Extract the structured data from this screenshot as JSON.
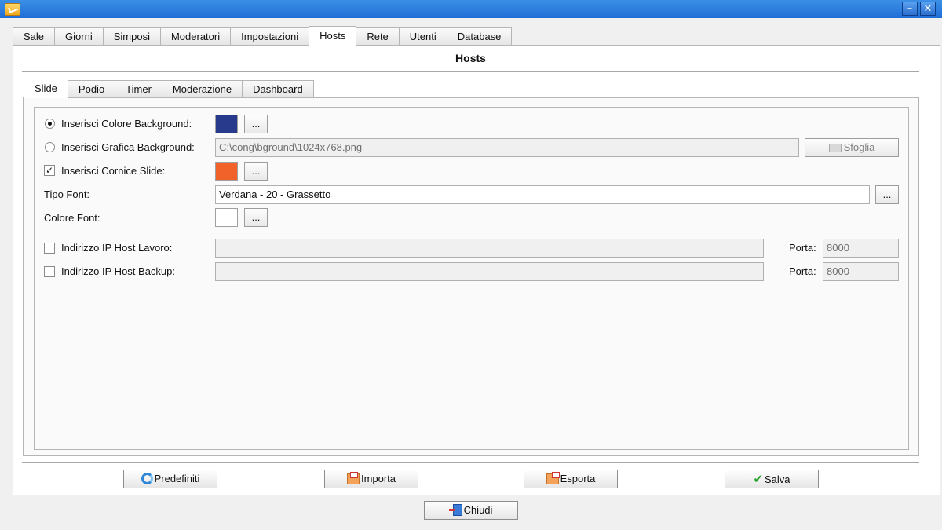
{
  "window": {
    "app_icon": "pencil-note-icon",
    "controls": {
      "minimize": "–",
      "close": "✕"
    }
  },
  "main_tabs": [
    {
      "label": "Sale"
    },
    {
      "label": "Giorni"
    },
    {
      "label": "Simposi"
    },
    {
      "label": "Moderatori"
    },
    {
      "label": "Impostazioni"
    },
    {
      "label": "Hosts",
      "active": true
    },
    {
      "label": "Rete"
    },
    {
      "label": "Utenti"
    },
    {
      "label": "Database"
    }
  ],
  "page_title": "Hosts",
  "sub_tabs": [
    {
      "label": "Slide",
      "active": true
    },
    {
      "label": "Podio"
    },
    {
      "label": "Timer"
    },
    {
      "label": "Moderazione"
    },
    {
      "label": "Dashboard"
    }
  ],
  "slide": {
    "background_color": {
      "label": "Inserisci Colore Background:",
      "selected": true,
      "color": "#273a8c",
      "browse_label": "..."
    },
    "background_image": {
      "label": "Inserisci Grafica Background:",
      "selected": false,
      "path": "C:\\cong\\bground\\1024x768.png",
      "browse_label": "Sfoglia",
      "browse_icon": "folder-icon"
    },
    "slide_frame": {
      "label": "Inserisci Cornice Slide:",
      "checked": true,
      "color": "#f0622a",
      "browse_label": "..."
    },
    "font_type": {
      "label": "Tipo Font:",
      "value": "Verdana - 20 - Grassetto",
      "browse_label": "..."
    },
    "font_color": {
      "label": "Colore Font:",
      "color": "#ffffff",
      "browse_label": "..."
    },
    "host_work": {
      "label": "Indirizzo IP Host Lavoro:",
      "checked": false,
      "ip": "",
      "port_label": "Porta:",
      "port": "8000"
    },
    "host_backup": {
      "label": "Indirizzo IP Host Backup:",
      "checked": false,
      "ip": "",
      "port_label": "Porta:",
      "port": "8000"
    }
  },
  "buttons": {
    "defaults": {
      "label": "Predefiniti",
      "icon": "refresh-icon"
    },
    "import": {
      "label": "Importa",
      "icon": "import-folder-icon"
    },
    "export": {
      "label": "Esporta",
      "icon": "export-folder-icon"
    },
    "save": {
      "label": "Salva",
      "icon": "checkmark-icon"
    },
    "close": {
      "label": "Chiudi",
      "icon": "exit-door-icon"
    }
  },
  "colors": {
    "titlebar": "#2a7ae0",
    "selected_background": "#273a8c",
    "frame_color": "#f0622a"
  }
}
